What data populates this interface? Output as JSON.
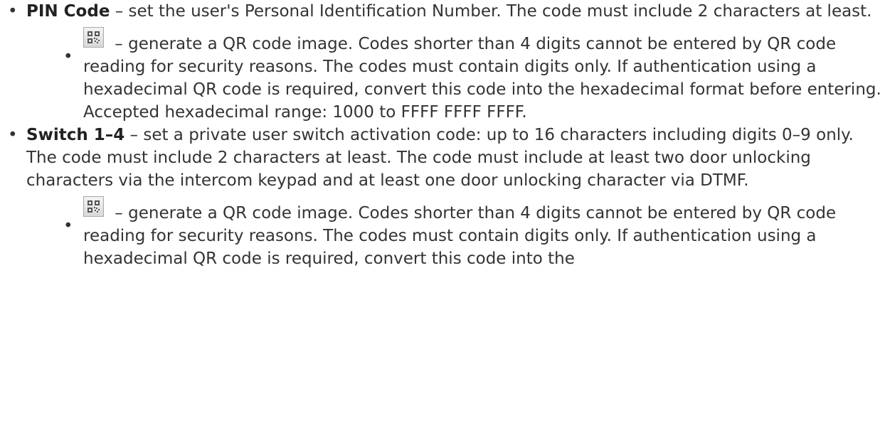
{
  "items": [
    {
      "term": "PIN Code",
      "text": " – set the user's Personal Identification Number. The code must include 2 characters at least.",
      "sub": {
        "icon": "qr-code-icon",
        "text": " –  generate a QR code image. Codes shorter than 4 digits cannot be entered by QR code reading for security reasons.  The codes must contain digits only. If authentication using a hexadecimal QR code is required, convert this code into the hexadecimal format before entering. Accepted hexadecimal range: 1000 to FFFF FFFF FFFF."
      }
    },
    {
      "term": "Switch 1–4",
      "text": " – set a private user switch activation code: up to 16 characters including digits 0–9 only. The code must include 2 characters at least. The code must include at least two door unlocking characters via the intercom keypad and at least one door unlocking character via DTMF.",
      "sub": {
        "icon": "qr-code-icon",
        "text": " – generate a QR code image. Codes shorter than 4 digits cannot be entered by QR code reading for security reasons.  The codes must contain digits only. If authentication using a hexadecimal QR code is required, convert this code into the"
      }
    }
  ]
}
